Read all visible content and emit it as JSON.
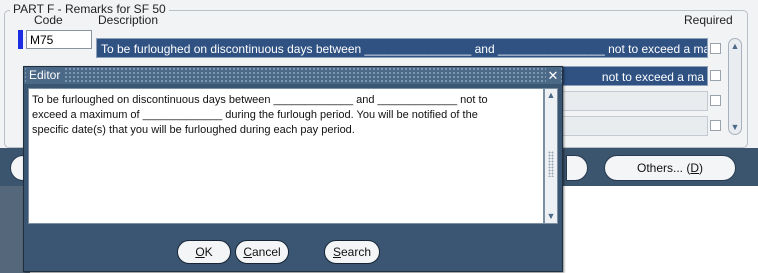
{
  "section": {
    "legend": "PART F - Remarks for SF 50",
    "col_code": "Code",
    "col_description": "Description",
    "col_required": "Required"
  },
  "rows": [
    {
      "code": "M75",
      "description": "To be furloughed on discontinuous days between ________________ and ________________ not to exceed a ma"
    },
    {
      "code": "",
      "description": "not to exceed a ma"
    },
    {
      "code": "",
      "description": ""
    },
    {
      "code": "",
      "description": ""
    }
  ],
  "background_buttons": {
    "others_label": "Others... (",
    "others_key": "D",
    "others_tail": ")"
  },
  "editor": {
    "title": "Editor",
    "close_glyph": "✕",
    "text_lines": [
      "To be furloughed on discontinuous days between _____________ and _____________ not to",
      "exceed a maximum of _____________ during the furlough period. You will be notified of the",
      "specific date(s) that you will be furloughed during each pay period."
    ],
    "ok_key": "O",
    "ok_rest": "K",
    "cancel_key": "C",
    "cancel_rest": "ancel",
    "search_key": "S",
    "search_rest": "earch"
  },
  "colors": {
    "selected_row": "#2f5283",
    "editor_frame": "#3a5673",
    "marker": "#1b2ce3"
  }
}
